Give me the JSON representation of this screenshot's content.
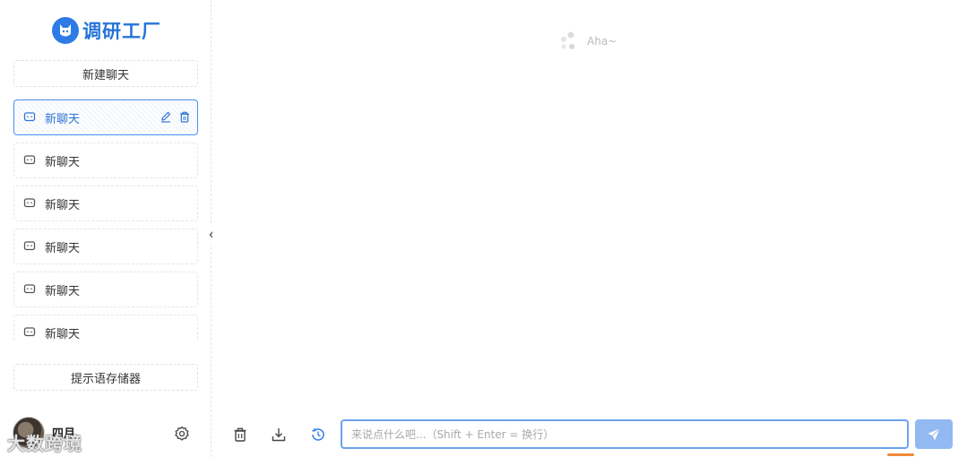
{
  "brand": {
    "name": "调研工厂",
    "logo_icon": "cat-logo-icon"
  },
  "sidebar": {
    "new_chat_label": "新建聊天",
    "chats": [
      {
        "title": "新聊天",
        "active": true
      },
      {
        "title": "新聊天",
        "active": false
      },
      {
        "title": "新聊天",
        "active": false
      },
      {
        "title": "新聊天",
        "active": false
      },
      {
        "title": "新聊天",
        "active": false
      },
      {
        "title": "新聊天",
        "active": false
      }
    ],
    "prompt_store_label": "提示语存储器",
    "user": {
      "name": "四月"
    },
    "watermark": "大数跨境"
  },
  "main": {
    "loading_text": "Aha~",
    "input": {
      "placeholder": "来说点什么吧...（Shift + Enter = 换行）",
      "value": ""
    }
  },
  "colors": {
    "accent": "#2e7be6",
    "active_border": "#4b8ef5",
    "input_border": "#6da1ee",
    "send_button": "#93b9f2"
  }
}
